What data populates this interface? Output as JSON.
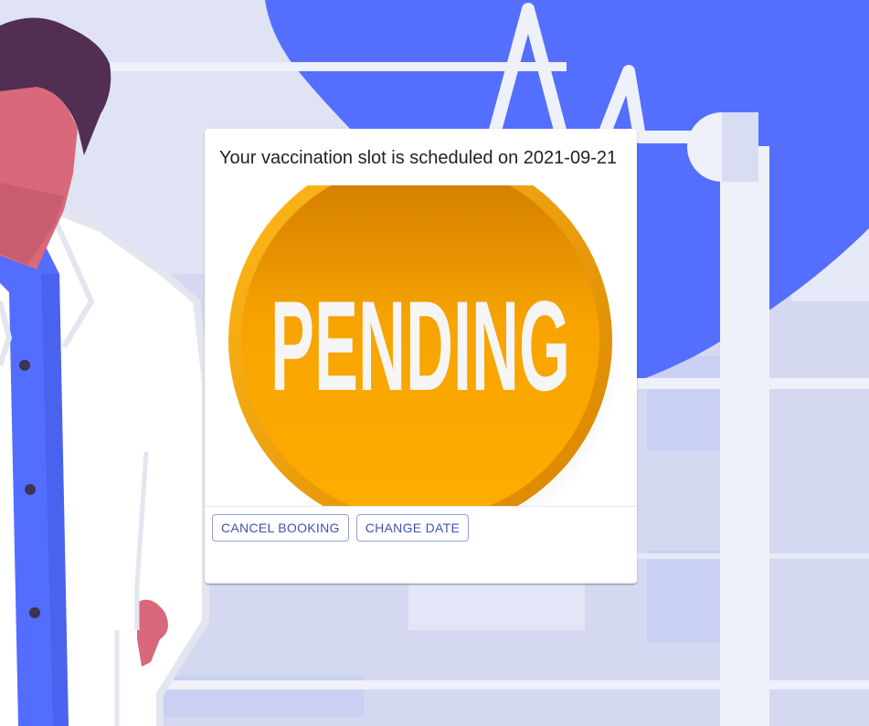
{
  "card": {
    "title": "Your vaccination slot is scheduled on 2021-09-21",
    "status_badge_text": "PENDING",
    "status_badge_color": "#ffa500"
  },
  "actions": {
    "cancel_label": "CANCEL BOOKING",
    "change_date_label": "CHANGE DATE"
  },
  "theme": {
    "accent": "#3f51b5",
    "background_blue": "#546ffe",
    "doctor_scrubs": "#536dfe"
  }
}
